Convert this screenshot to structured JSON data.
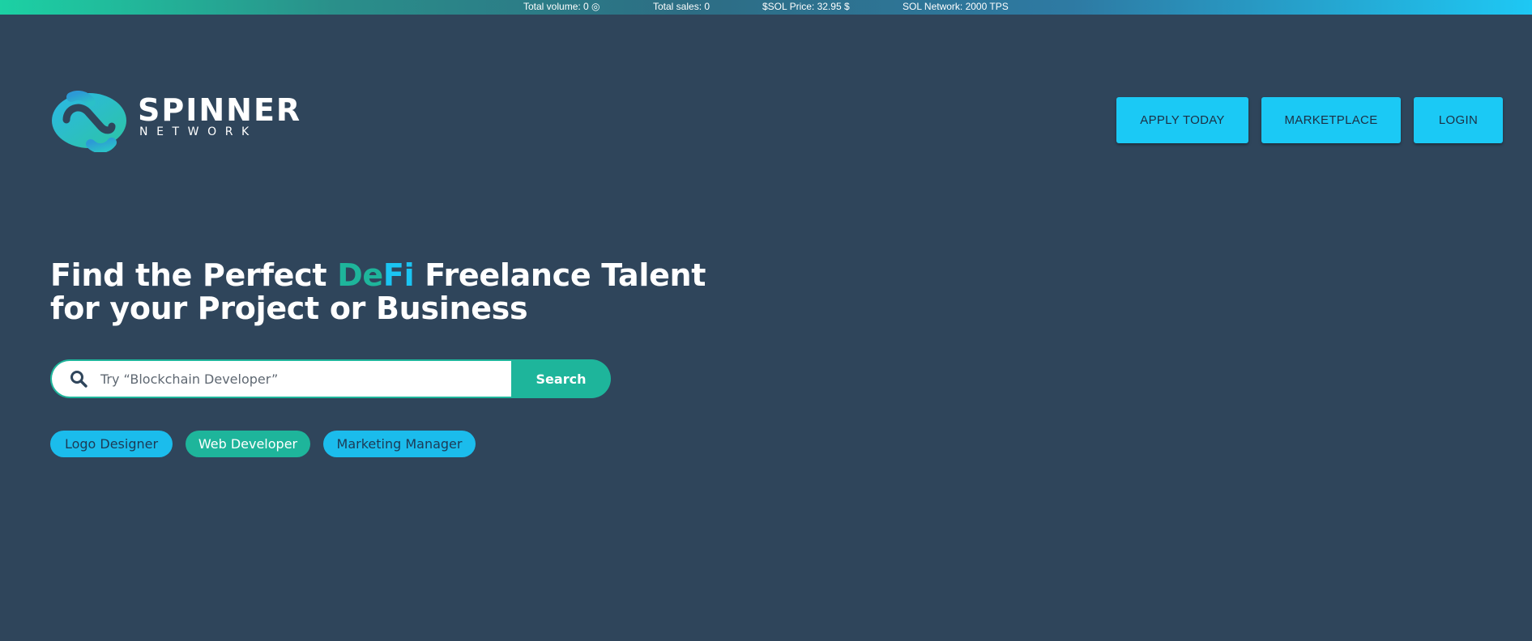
{
  "ticker": {
    "total_volume": "Total volume: 0 ◎",
    "total_sales": "Total sales: 0",
    "sol_price": "$SOL Price: 32.95 $",
    "sol_network": "SOL Network: 2000 TPS"
  },
  "logo": {
    "word": "SPINNER",
    "sub": "NETWORK",
    "icon": "spinner-logo-icon"
  },
  "nav": {
    "apply": "APPLY TODAY",
    "marketplace": "MARKETPLACE",
    "login": "LOGIN"
  },
  "hero": {
    "line1_pre": "Find the Perfect ",
    "line1_de": "De",
    "line1_fi": "Fi",
    "line1_post": " Freelance Talent",
    "line2": "for your Project or Business"
  },
  "search": {
    "placeholder": "Try “Blockchain Developer”",
    "value": "",
    "button": "Search",
    "icon": "search-icon"
  },
  "tags": [
    "Logo Designer",
    "Web Developer",
    "Marketing Manager"
  ],
  "colors": {
    "background": "#2f455b",
    "accent_cyan": "#1bc9f5",
    "accent_teal": "#1eb59b",
    "text_white": "#ffffff"
  }
}
